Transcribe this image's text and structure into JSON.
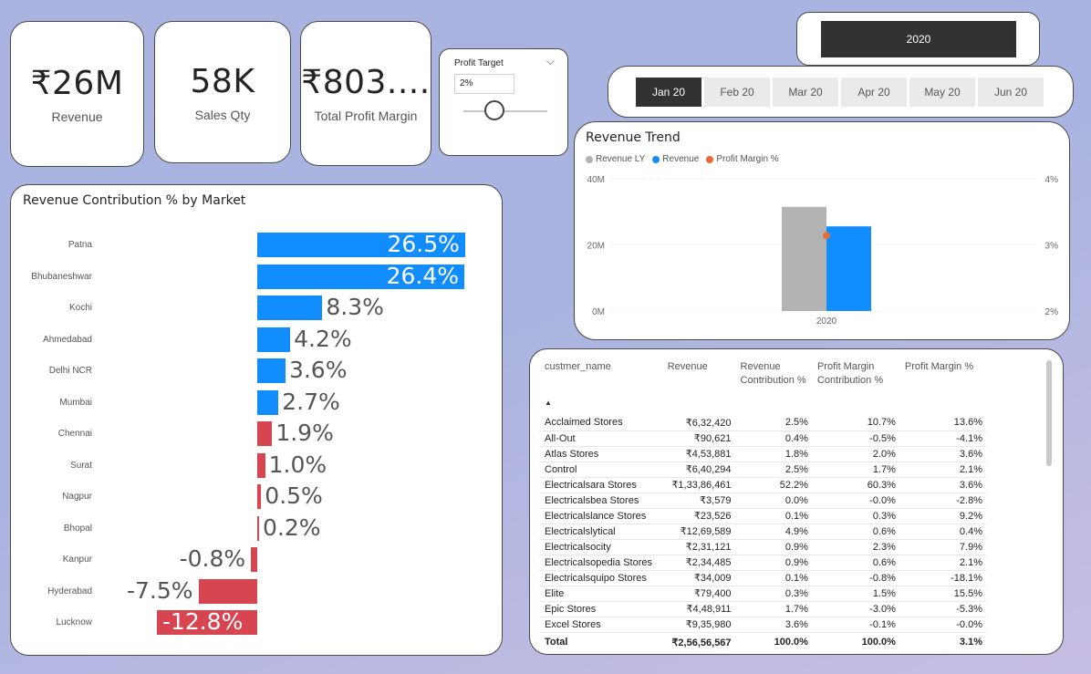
{
  "kpis": {
    "revenue": {
      "value": "₹26M",
      "label": "Revenue"
    },
    "sales_qty": {
      "value": "58K",
      "label": "Sales Qty"
    },
    "profit_margin": {
      "value": "₹803....",
      "label": "Total Profit Margin"
    }
  },
  "profit_target": {
    "title": "Profit Target",
    "value": "2%",
    "slider_level": 0.25
  },
  "year_slicer": {
    "selected": "2020"
  },
  "month_slicer": {
    "months": [
      "Jan 20",
      "Feb 20",
      "Mar 20",
      "Apr 20",
      "May 20",
      "Jun 20"
    ],
    "selected_index": 0
  },
  "market_chart": {
    "title": "Revenue Contribution % by Market",
    "rows": [
      {
        "market": "Patna",
        "value": 26.5,
        "label": "26.5%"
      },
      {
        "market": "Bhubaneshwar",
        "value": 26.4,
        "label": "26.4%"
      },
      {
        "market": "Kochi",
        "value": 8.3,
        "label": "8.3%"
      },
      {
        "market": "Ahmedabad",
        "value": 4.2,
        "label": "4.2%"
      },
      {
        "market": "Delhi NCR",
        "value": 3.6,
        "label": "3.6%"
      },
      {
        "market": "Mumbai",
        "value": 2.7,
        "label": "2.7%"
      },
      {
        "market": "Chennai",
        "value": 1.9,
        "label": "1.9%"
      },
      {
        "market": "Surat",
        "value": 1.0,
        "label": "1.0%"
      },
      {
        "market": "Nagpur",
        "value": 0.5,
        "label": "0.5%"
      },
      {
        "market": "Bhopal",
        "value": 0.2,
        "label": "0.2%"
      },
      {
        "market": "Kanpur",
        "value": -0.8,
        "label": "-0.8%"
      },
      {
        "market": "Hyderabad",
        "value": -7.5,
        "label": "-7.5%"
      },
      {
        "market": "Lucknow",
        "value": -12.8,
        "label": "-12.8%"
      }
    ],
    "colors": {
      "above_target": "#118dff",
      "below_target": "#d64550"
    },
    "blue_count": 6
  },
  "trend": {
    "title": "Revenue Trend",
    "legend": [
      {
        "name": "Revenue LY",
        "color": "#b3b3b3"
      },
      {
        "name": "Revenue",
        "color": "#118dff"
      },
      {
        "name": "Profit Margin %",
        "color": "#e66c37"
      }
    ],
    "y_left_ticks": [
      "40M",
      "20M",
      "0M"
    ],
    "y_right_ticks": [
      "4%",
      "3%",
      "2%"
    ],
    "x_label": "2020"
  },
  "chart_data": {
    "type": "bar",
    "categories": [
      "2020"
    ],
    "series": [
      {
        "name": "Revenue LY",
        "values": [
          31500000
        ]
      },
      {
        "name": "Revenue",
        "values": [
          25600000
        ]
      },
      {
        "name": "Profit Margin %",
        "values": [
          3.14
        ]
      }
    ],
    "ylim": [
      0,
      40000000
    ],
    "y2lim": [
      2,
      4
    ]
  },
  "table": {
    "headers": [
      "custmer_name",
      "Revenue",
      "Revenue Contribution %",
      "Profit Margin Contribution %",
      "Profit Margin %"
    ],
    "rows": [
      [
        "Acclaimed Stores",
        "₹6,32,420",
        "2.5%",
        "10.7%",
        "13.6%"
      ],
      [
        "All-Out",
        "₹90,621",
        "0.4%",
        "-0.5%",
        "-4.1%"
      ],
      [
        "Atlas Stores",
        "₹4,53,881",
        "1.8%",
        "2.0%",
        "3.6%"
      ],
      [
        "Control",
        "₹6,40,294",
        "2.5%",
        "1.7%",
        "2.1%"
      ],
      [
        "Electricalsara Stores",
        "₹1,33,86,461",
        "52.2%",
        "60.3%",
        "3.6%"
      ],
      [
        "Electricalsbea Stores",
        "₹3,579",
        "0.0%",
        "-0.0%",
        "-2.8%"
      ],
      [
        "Electricalslance Stores",
        "₹23,526",
        "0.1%",
        "0.3%",
        "9.2%"
      ],
      [
        "Electricalslytical",
        "₹12,69,589",
        "4.9%",
        "0.6%",
        "0.4%"
      ],
      [
        "Electricalsocity",
        "₹2,31,121",
        "0.9%",
        "2.3%",
        "7.9%"
      ],
      [
        "Electricalsopedia Stores",
        "₹2,34,485",
        "0.9%",
        "0.6%",
        "2.1%"
      ],
      [
        "Electricalsquipo Stores",
        "₹34,009",
        "0.1%",
        "-0.8%",
        "-18.1%"
      ],
      [
        "Elite",
        "₹79,400",
        "0.3%",
        "1.5%",
        "15.5%"
      ],
      [
        "Epic Stores",
        "₹4,48,911",
        "1.7%",
        "-3.0%",
        "-5.3%"
      ],
      [
        "Excel Stores",
        "₹9,35,980",
        "3.6%",
        "-0.1%",
        "-0.0%"
      ]
    ],
    "total": [
      "Total",
      "₹2,56,56,567",
      "100.0%",
      "100.0%",
      "3.1%"
    ]
  }
}
